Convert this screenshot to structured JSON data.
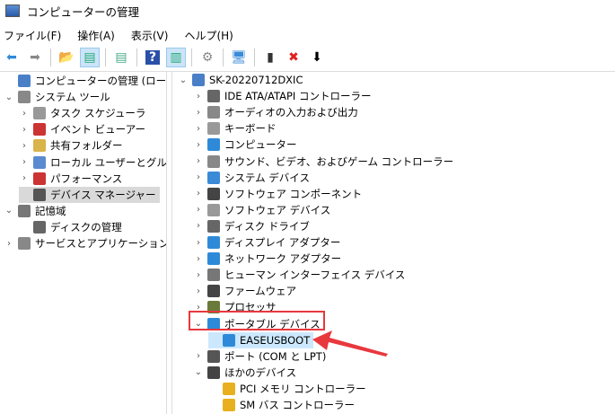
{
  "window": {
    "title": "コンピューターの管理"
  },
  "menu": [
    "ファイル(F)",
    "操作(A)",
    "表示(V)",
    "ヘルプ(H)"
  ],
  "toolbar": [
    {
      "icon": "back-arrow-icon",
      "g": "⬅",
      "c": "#2f8ad8"
    },
    {
      "icon": "forward-arrow-icon",
      "g": "➡",
      "c": "#888"
    },
    {
      "sep": true
    },
    {
      "icon": "up-folder-icon",
      "g": "📂",
      "c": "#c9a43c"
    },
    {
      "icon": "show-hide-tree-icon",
      "g": "▤",
      "c": "#2a7",
      "sel": true
    },
    {
      "sep": true
    },
    {
      "icon": "properties-icon",
      "g": "▤",
      "c": "#4a8"
    },
    {
      "sep": true
    },
    {
      "icon": "help-icon",
      "g": "?",
      "c": "#fff",
      "bg": "#2a4fa8"
    },
    {
      "icon": "action-pane-icon",
      "g": "▥",
      "c": "#2a7",
      "sel": true
    },
    {
      "sep": true
    },
    {
      "icon": "update-driver-icon",
      "g": "⚙",
      "c": "#888"
    },
    {
      "sep": true
    },
    {
      "icon": "scan-hardware-icon",
      "g": "🖥",
      "c": "#3a8ad8"
    },
    {
      "sep": true
    },
    {
      "icon": "enable-device-icon",
      "g": "▮",
      "c": "#333"
    },
    {
      "icon": "uninstall-icon",
      "g": "✖",
      "c": "#e02020"
    },
    {
      "icon": "download-icon",
      "g": "⬇",
      "c": "#000"
    }
  ],
  "left_tree": [
    {
      "label": "コンピューターの管理 (ローカル)",
      "depth": 0,
      "exp": "",
      "color": "#4a7fc8"
    },
    {
      "label": "システム ツール",
      "depth": 0,
      "exp": "⌄",
      "color": "#888"
    },
    {
      "label": "タスク スケジューラ",
      "depth": 1,
      "exp": "›",
      "color": "#999"
    },
    {
      "label": "イベント ビューアー",
      "depth": 1,
      "exp": "›",
      "color": "#c33"
    },
    {
      "label": "共有フォルダー",
      "depth": 1,
      "exp": "›",
      "color": "#d9b44a"
    },
    {
      "label": "ローカル ユーザーとグループ",
      "depth": 1,
      "exp": "›",
      "color": "#5a8ad0"
    },
    {
      "label": "パフォーマンス",
      "depth": 1,
      "exp": "›",
      "color": "#c33"
    },
    {
      "label": "デバイス マネージャー",
      "depth": 1,
      "exp": "",
      "color": "#555",
      "selected": true
    },
    {
      "label": "記憶域",
      "depth": 0,
      "exp": "⌄",
      "color": "#777"
    },
    {
      "label": "ディスクの管理",
      "depth": 1,
      "exp": "",
      "color": "#666"
    },
    {
      "label": "サービスとアプリケーション",
      "depth": 0,
      "exp": "›",
      "color": "#888"
    }
  ],
  "right_tree": [
    {
      "label": "SK-20220712DXIC",
      "depth": 0,
      "exp": "⌄",
      "color": "#4a7fc8"
    },
    {
      "label": "IDE ATA/ATAPI コントローラー",
      "depth": 1,
      "exp": "›",
      "color": "#666"
    },
    {
      "label": "オーディオの入力および出力",
      "depth": 1,
      "exp": "›",
      "color": "#888"
    },
    {
      "label": "キーボード",
      "depth": 1,
      "exp": "›",
      "color": "#999"
    },
    {
      "label": "コンピューター",
      "depth": 1,
      "exp": "›",
      "color": "#2e8ad8"
    },
    {
      "label": "サウンド、ビデオ、およびゲーム コントローラー",
      "depth": 1,
      "exp": "›",
      "color": "#888"
    },
    {
      "label": "システム デバイス",
      "depth": 1,
      "exp": "›",
      "color": "#3a8ad8"
    },
    {
      "label": "ソフトウェア コンポーネント",
      "depth": 1,
      "exp": "›",
      "color": "#444"
    },
    {
      "label": "ソフトウェア デバイス",
      "depth": 1,
      "exp": "›",
      "color": "#999"
    },
    {
      "label": "ディスク ドライブ",
      "depth": 1,
      "exp": "›",
      "color": "#666"
    },
    {
      "label": "ディスプレイ アダプター",
      "depth": 1,
      "exp": "›",
      "color": "#2e8ad8"
    },
    {
      "label": "ネットワーク アダプター",
      "depth": 1,
      "exp": "›",
      "color": "#2e8ad8"
    },
    {
      "label": "ヒューマン インターフェイス デバイス",
      "depth": 1,
      "exp": "›",
      "color": "#777"
    },
    {
      "label": "ファームウェア",
      "depth": 1,
      "exp": "›",
      "color": "#444"
    },
    {
      "label": "プロセッサ",
      "depth": 1,
      "exp": "›",
      "color": "#6a7a3a"
    },
    {
      "label": "ポータブル デバイス",
      "depth": 1,
      "exp": "⌄",
      "color": "#2e8ad8"
    },
    {
      "label": "EASEUSBOOT",
      "depth": 2,
      "exp": "",
      "color": "#2e8ad8",
      "highlighted": true
    },
    {
      "label": "ポート (COM と LPT)",
      "depth": 1,
      "exp": "›",
      "color": "#555"
    },
    {
      "label": "ほかのデバイス",
      "depth": 1,
      "exp": "⌄",
      "color": "#444"
    },
    {
      "label": "PCI メモリ コントローラー",
      "depth": 2,
      "exp": "",
      "color": "#e8b020"
    },
    {
      "label": "SM バス コントローラー",
      "depth": 2,
      "exp": "",
      "color": "#e8b020"
    }
  ],
  "annotation_color": "#e8383d"
}
